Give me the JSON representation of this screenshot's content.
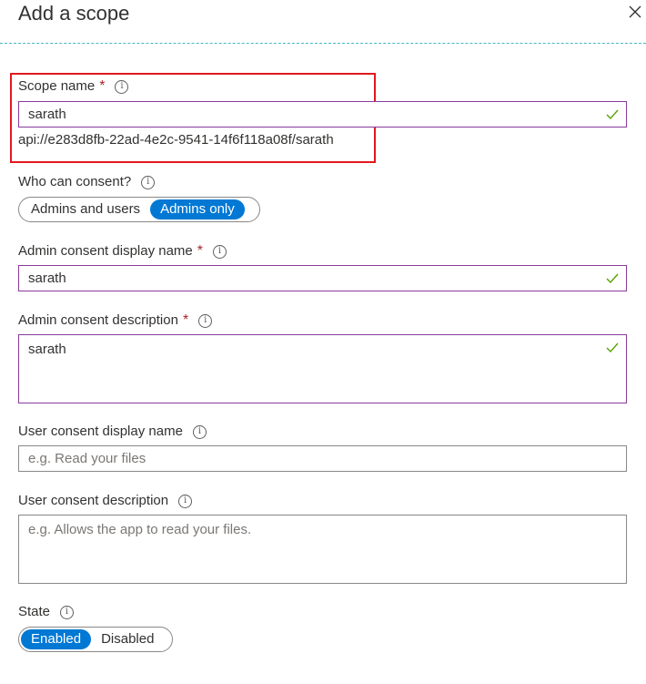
{
  "panel": {
    "title": "Add a scope",
    "close_label": "×"
  },
  "fields": {
    "scope_name": {
      "label": "Scope name",
      "required": "*",
      "value": "sarath",
      "api_uri": "api://e283d8fb-22ad-4e2c-9541-14f6f118a08f/sarath"
    },
    "who_can_consent": {
      "label": "Who can consent?",
      "options": [
        "Admins and users",
        "Admins only"
      ],
      "selected": "Admins only"
    },
    "admin_consent_display_name": {
      "label": "Admin consent display name",
      "required": "*",
      "value": "sarath"
    },
    "admin_consent_description": {
      "label": "Admin consent description",
      "required": "*",
      "value": "sarath"
    },
    "user_consent_display_name": {
      "label": "User consent display name",
      "placeholder": "e.g. Read your files",
      "value": ""
    },
    "user_consent_description": {
      "label": "User consent description",
      "placeholder": "e.g. Allows the app to read your files.",
      "value": ""
    },
    "state": {
      "label": "State",
      "options": [
        "Enabled",
        "Disabled"
      ],
      "selected": "Enabled"
    }
  },
  "colors": {
    "accent": "#0078d4",
    "valid_check": "#57a300",
    "highlight_box": "#e3181f",
    "input_border_active": "#8a3a9b",
    "divider": "#46b8c5"
  }
}
